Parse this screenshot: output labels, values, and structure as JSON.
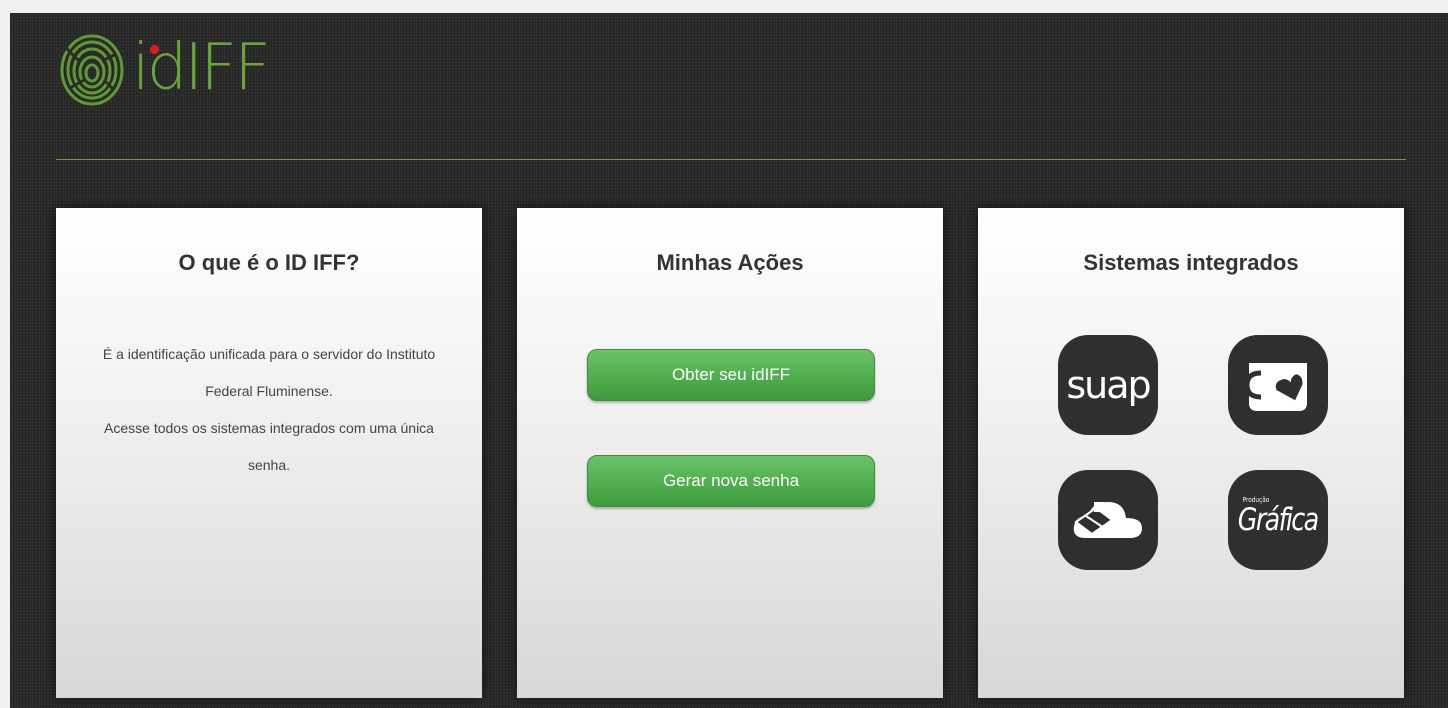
{
  "header": {
    "logo_text": "idIFF",
    "logo_icon": "fingerprint-icon"
  },
  "cards": {
    "about": {
      "title": "O que é o ID IFF?",
      "paragraph1": "É a identificação unificada para o servidor do Instituto Federal Fluminense.",
      "paragraph2": "Acesse todos os sistemas integrados com uma única senha."
    },
    "actions": {
      "title": "Minhas Ações",
      "get_id_label": "Obter seu idIFF",
      "new_password_label": "Gerar nova senha"
    },
    "systems": {
      "title": "Sistemas integrados",
      "suap_label": "suap",
      "grafica_label": "Gráfica",
      "grafica_sub": "Produção"
    }
  },
  "colors": {
    "accent": "#6aa33a",
    "button": "#4fae4d",
    "logo_dot": "#e11a1a"
  }
}
